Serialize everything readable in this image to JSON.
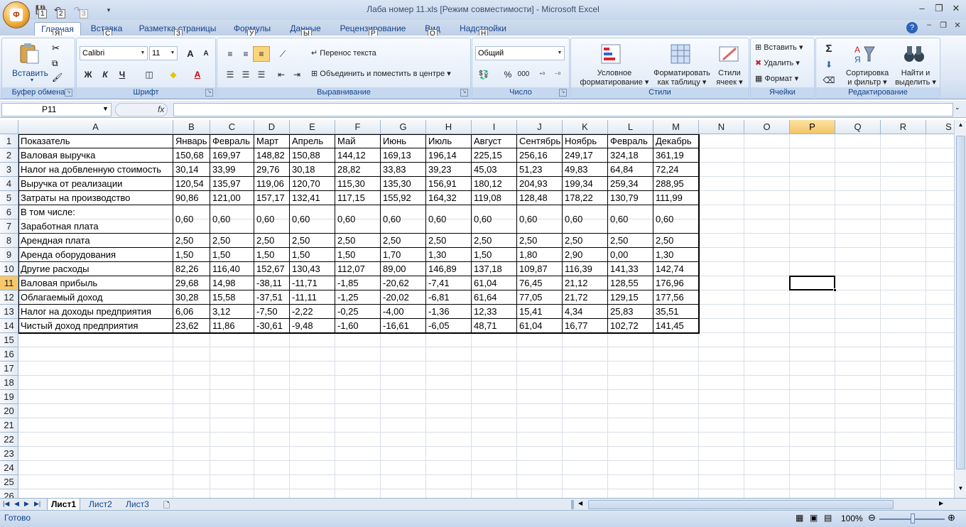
{
  "window": {
    "title": "Лаба номер 11.xls  [Режим совместимости] - Microsoft Excel",
    "office_button_badge": "Ф",
    "qat_keytips": [
      "1",
      "2",
      "3"
    ],
    "controls": [
      "–",
      "❐",
      "✕"
    ]
  },
  "tabs": [
    {
      "label": "Главная",
      "key": "Я"
    },
    {
      "label": "Вставка",
      "key": "С"
    },
    {
      "label": "Разметка страницы",
      "key": "З"
    },
    {
      "label": "Формулы",
      "key": "У"
    },
    {
      "label": "Данные",
      "key": "Ы"
    },
    {
      "label": "Рецензирование",
      "key": "Р"
    },
    {
      "label": "Вид",
      "key": "О"
    },
    {
      "label": "Надстройки",
      "key": "Н"
    }
  ],
  "ribbon": {
    "clipboard": {
      "label": "Буфер обмена",
      "paste": "Вставить"
    },
    "font": {
      "label": "Шрифт",
      "name": "Calibri",
      "size": "11",
      "bold": "Ж",
      "italic": "К",
      "underline": "Ч",
      "grow": "A",
      "shrink": "A",
      "fontcolor": "A"
    },
    "alignment": {
      "label": "Выравнивание",
      "wrap": "Перенос текста",
      "merge": "Объединить и поместить в центре"
    },
    "number": {
      "label": "Число",
      "format": "Общий",
      "percent": "%",
      "thousands": "000"
    },
    "styles": {
      "label": "Стили",
      "cond1": "Условное",
      "cond2": "форматирование",
      "table1": "Форматировать",
      "table2": "как таблицу",
      "cell1": "Стили",
      "cell2": "ячеек"
    },
    "cells": {
      "label": "Ячейки",
      "insert": "Вставить",
      "delete": "Удалить",
      "format": "Формат"
    },
    "editing": {
      "label": "Редактирование",
      "sort1": "Сортировка",
      "sort2": "и фильтр",
      "find1": "Найти и",
      "find2": "выделить",
      "sigma": "Σ"
    }
  },
  "formula_bar": {
    "name_box": "P11",
    "fx": "fx",
    "value": ""
  },
  "columns": [
    {
      "letter": "A"
    },
    {
      "letter": "B"
    },
    {
      "letter": "C"
    },
    {
      "letter": "D"
    },
    {
      "letter": "E"
    },
    {
      "letter": "F"
    },
    {
      "letter": "G"
    },
    {
      "letter": "H"
    },
    {
      "letter": "I"
    },
    {
      "letter": "J"
    },
    {
      "letter": "K"
    },
    {
      "letter": "L"
    },
    {
      "letter": "M"
    },
    {
      "letter": "N"
    },
    {
      "letter": "O"
    },
    {
      "letter": "P"
    },
    {
      "letter": "Q"
    },
    {
      "letter": "R"
    },
    {
      "letter": "S"
    }
  ],
  "selected": {
    "col": "P",
    "row": 11
  },
  "row_numbers": [
    "1",
    "2",
    "3",
    "4",
    "5",
    "6",
    "7",
    "8",
    "9",
    "10",
    "11",
    "12",
    "13",
    "14",
    "15",
    "16",
    "17",
    "18",
    "19",
    "20",
    "21",
    "22",
    "23",
    "24",
    "25",
    "26"
  ],
  "table_rows": [
    {
      "row": "1",
      "label": "Показатель",
      "values": [
        "Январь",
        "Февраль",
        "Март",
        "Апрель",
        "Май",
        "Июнь",
        "Июль",
        "Август",
        "Сентябрь",
        "Ноябрь",
        "Февраль",
        "Декабрь"
      ]
    },
    {
      "row": "2",
      "label": "Валовая выручка",
      "values": [
        "150,68",
        "169,97",
        "148,82",
        "150,88",
        "144,12",
        "169,13",
        "196,14",
        "225,15",
        "256,16",
        "249,17",
        "324,18",
        "361,19"
      ]
    },
    {
      "row": "3",
      "label": "Налог на добвленную стоимость",
      "values": [
        "30,14",
        "33,99",
        "29,76",
        "30,18",
        "28,82",
        "33,83",
        "39,23",
        "45,03",
        "51,23",
        "49,83",
        "64,84",
        "72,24"
      ]
    },
    {
      "row": "4",
      "label": "Выручка от реализации",
      "values": [
        "120,54",
        "135,97",
        "119,06",
        "120,70",
        "115,30",
        "135,30",
        "156,91",
        "180,12",
        "204,93",
        "199,34",
        "259,34",
        "288,95"
      ]
    },
    {
      "row": "5",
      "label": "Затраты на производство",
      "values": [
        "90,86",
        "121,00",
        "157,17",
        "132,41",
        "117,15",
        "155,92",
        "164,32",
        "119,08",
        "128,48",
        "178,22",
        "130,79",
        "111,99"
      ]
    },
    {
      "row": "6-7",
      "label": "В том числе:",
      "label2": "Заработная плата",
      "values": [
        "0,60",
        "0,60",
        "0,60",
        "0,60",
        "0,60",
        "0,60",
        "0,60",
        "0,60",
        "0,60",
        "0,60",
        "0,60",
        "0,60"
      ]
    },
    {
      "row": "8",
      "label": "Арендная плата",
      "values": [
        "2,50",
        "2,50",
        "2,50",
        "2,50",
        "2,50",
        "2,50",
        "2,50",
        "2,50",
        "2,50",
        "2,50",
        "2,50",
        "2,50"
      ]
    },
    {
      "row": "9",
      "label": "Аренда оборудования",
      "values": [
        "1,50",
        "1,50",
        "1,50",
        "1,50",
        "1,50",
        "1,70",
        "1,30",
        "1,50",
        "1,80",
        "2,90",
        "0,00",
        "1,30"
      ]
    },
    {
      "row": "10",
      "label": "Другие расходы",
      "values": [
        "82,26",
        "116,40",
        "152,67",
        "130,43",
        "112,07",
        "89,00",
        "146,89",
        "137,18",
        "109,87",
        "116,39",
        "141,33",
        "142,74"
      ]
    },
    {
      "row": "11",
      "label": "Валовая прибыль",
      "values": [
        "29,68",
        "14,98",
        "-38,11",
        "-11,71",
        "-1,85",
        "-20,62",
        "-7,41",
        "61,04",
        "76,45",
        "21,12",
        "128,55",
        "176,96"
      ]
    },
    {
      "row": "12",
      "label": "Облагаемый доход",
      "values": [
        "30,28",
        "15,58",
        "-37,51",
        "-11,11",
        "-1,25",
        "-20,02",
        "-6,81",
        "61,64",
        "77,05",
        "21,72",
        "129,15",
        "177,56"
      ]
    },
    {
      "row": "13",
      "label": "Налог на доходы предприятия",
      "values": [
        "6,06",
        "3,12",
        "-7,50",
        "-2,22",
        "-0,25",
        "-4,00",
        "-1,36",
        "12,33",
        "15,41",
        "4,34",
        "25,83",
        "35,51"
      ]
    },
    {
      "row": "14",
      "label": "Чистый доход предприятия",
      "values": [
        "23,62",
        "11,86",
        "-30,61",
        "-9,48",
        "-1,60",
        "-16,61",
        "-6,05",
        "48,71",
        "61,04",
        "16,77",
        "102,72",
        "141,45"
      ]
    }
  ],
  "sheets": [
    "Лист1",
    "Лист2",
    "Лист3"
  ],
  "status": {
    "ready": "Готово",
    "zoom": "100%"
  }
}
